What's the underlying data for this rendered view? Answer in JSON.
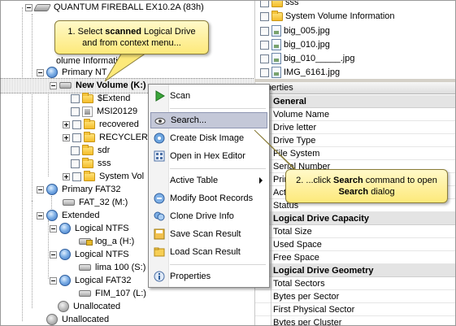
{
  "tree": {
    "root": "QUANTUM FIREBALL EX10.2A (83h)",
    "primary_ntfs_1": "Primary NTFS",
    "volume_info_partial": "olume Information",
    "primary_ntfs_2": "Primary NT",
    "selected_volume": "New Volume (K:)",
    "children": [
      "$Extend",
      "MSI20129",
      "recovered",
      "RECYCLER",
      "sdr",
      "sss",
      "System Vol"
    ],
    "primary_fat32": "Primary FAT32",
    "fat32_drive": "FAT_32 (M:)",
    "extended": "Extended",
    "logical_ntfs_1": "Logical NTFS",
    "log_a": "log_a (H:)",
    "logical_ntfs_2": "Logical NTFS",
    "lima": "lima 100 (S:)",
    "logical_fat32": "Logical FAT32",
    "fim": "FIM_107 (L:)",
    "unallocated_1": "Unallocated",
    "unallocated_2": "Unallocated"
  },
  "files": [
    "sss",
    "System Volume Information",
    "big_005.jpg",
    "big_010.jpg",
    "big_010_____.jpg",
    "IMG_6161.jpg"
  ],
  "properties": {
    "header": "roperties",
    "rows": [
      {
        "label": "General",
        "group": true
      },
      {
        "label": "Volume Name",
        "group": false
      },
      {
        "label": "Drive letter",
        "group": false
      },
      {
        "label": "Drive Type",
        "group": false
      },
      {
        "label": "File System",
        "group": false
      },
      {
        "label": "Serial Number",
        "group": false
      },
      {
        "label": "Primary",
        "group": false
      },
      {
        "label": "Active",
        "group": false
      },
      {
        "label": "Status",
        "group": false
      },
      {
        "label": "Logical Drive Capacity",
        "group": true
      },
      {
        "label": "Total Size",
        "group": false
      },
      {
        "label": "Used Space",
        "group": false
      },
      {
        "label": "Free Space",
        "group": false
      },
      {
        "label": "Logical Drive Geometry",
        "group": true
      },
      {
        "label": "Total Sectors",
        "group": false
      },
      {
        "label": "Bytes per Sector",
        "group": false
      },
      {
        "label": "First Physical Sector",
        "group": false
      },
      {
        "label": "Bytes per Cluster",
        "group": false
      }
    ]
  },
  "menu": {
    "scan": "Scan",
    "search": "Search...",
    "create_image": "Create Disk Image",
    "hex_editor": "Open in Hex Editor",
    "active_table": "Active Table",
    "modify_boot": "Modify Boot Records",
    "clone_info": "Clone Drive Info",
    "save_scan": "Save Scan Result",
    "load_scan": "Load Scan Result",
    "properties": "Properties"
  },
  "callouts": {
    "c1": {
      "pre": "1. Select ",
      "bold": "scanned",
      "post": " Logical Drive",
      "line2": "and from context menu..."
    },
    "c2": {
      "pre": "2. ...click ",
      "bold": "Search",
      "post": " command to open",
      "line2_bold": "Search",
      "line2": " dialog"
    }
  },
  "colors": {
    "highlight": "#c4c8d8",
    "callout": "#fde97a",
    "group_row": "#e4e4e4"
  }
}
